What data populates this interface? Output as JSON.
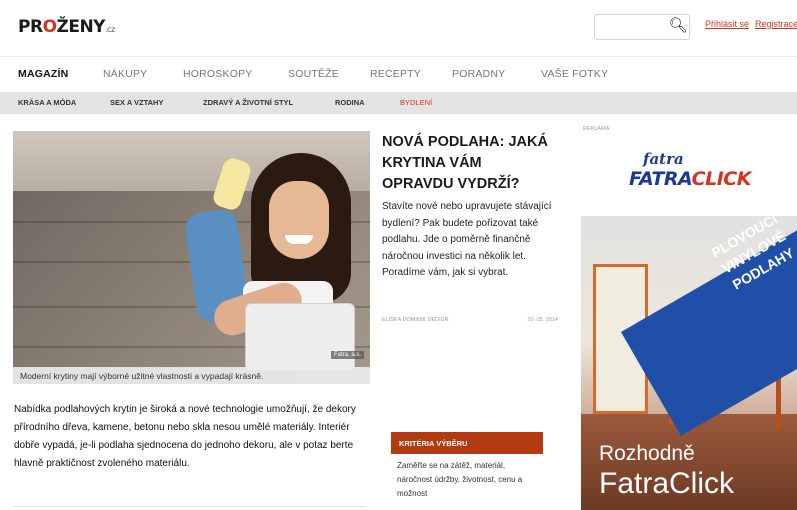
{
  "header": {
    "logo_text": "PROŽENY",
    "logo_tld": ".cz",
    "search_placeholder": "",
    "links": [
      "Přihlásit se",
      "Registrace"
    ]
  },
  "main_nav": [
    "MAGAZÍN",
    "NÁKUPY",
    "HOROSKOPY",
    "SOUTĚŽE",
    "RECEPTY",
    "PORADNY",
    "VAŠE FOTKY"
  ],
  "sub_nav": [
    "KRÁSA A MÓDA",
    "SEX A VZTAHY",
    "ZDRAVÝ A ŽIVOTNÍ STYL",
    "RODINA",
    "BYDLENÍ"
  ],
  "article": {
    "headline": "NOVÁ PODLAHA: JAKÁ KRYTINA VÁM OPRAVDU VYDRŽÍ?",
    "perex": "Stavíte nové nebo upravujete stávající bydlení? Pak budete pořizovat také podlahu. Jde o poměrně finančně náročnou investici na několik let. Poradíme vám, jak si vybrat.",
    "author": "ELIŠKA DOMINIK DEDIŮR",
    "date": "20. 05. 2014",
    "image_caption": "Moderní krytiny mají výborné užitné vlastnosti a vypadají krásně.",
    "image_credit": "Fatra, a.s.",
    "body": "Nabídka podlahových krytin je široká a nové technologie umožňují, že dekory přírodního dřeva, kamene, betonu nebo skla nesou umělé materiály. Interiér dobře vypadá, je-li podlaha sjednocena do jednoho dekoru, ale v potaz berte hlavně praktičnost zvoleného materiálu."
  },
  "criteria": {
    "title": "KRITÉRIA VÝBĚRU",
    "text": "Zaměřte se na zátěž, materiál, náročnost údržby, životnost, cenu a možnost"
  },
  "ad": {
    "label": "REKLAMA",
    "brand_small": "fatra",
    "brand_big_a": "FATRA",
    "brand_big_b": "CLICK",
    "ribbon": "PLOVOUCÍ VINYLOVÉ PODLAHY",
    "line1": "Rozhodně",
    "line2": "FatraClick"
  }
}
